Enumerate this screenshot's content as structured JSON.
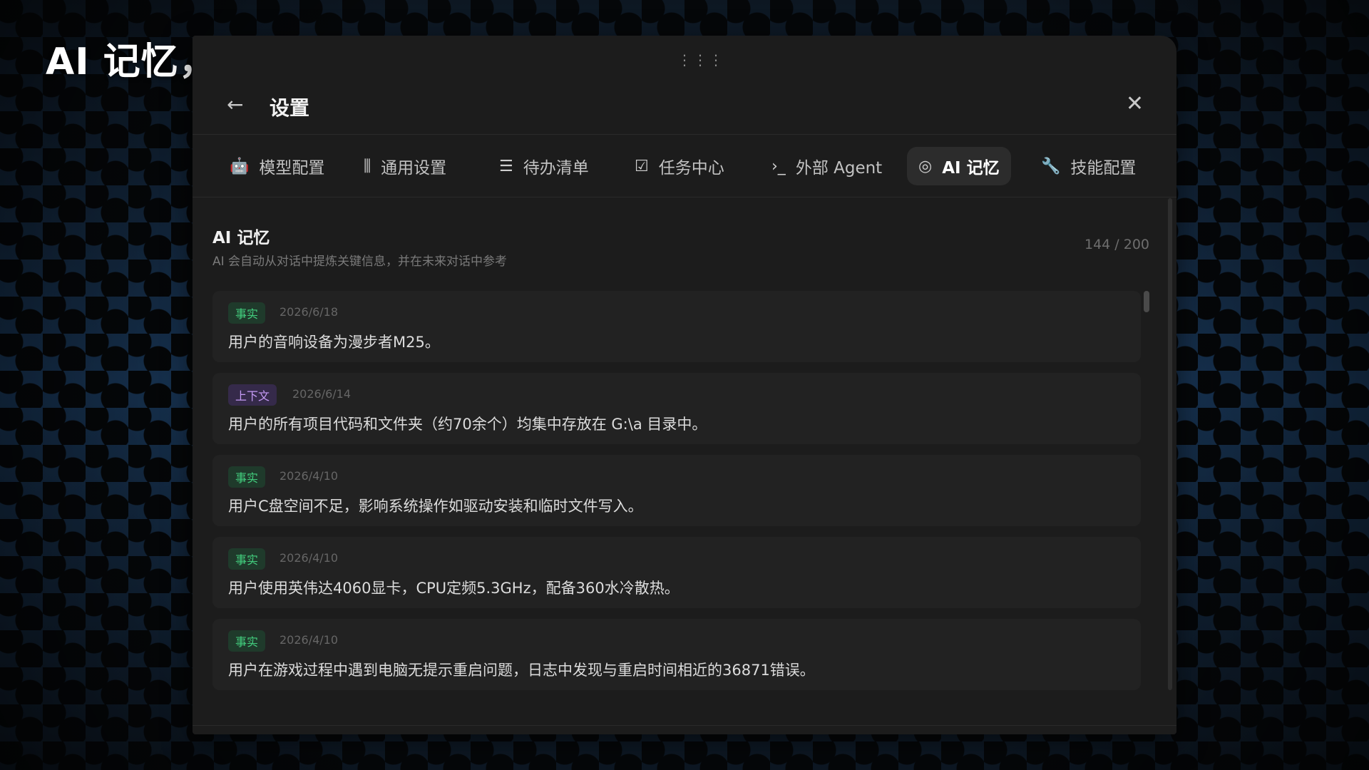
{
  "slogan": "AI 记忆，越用越懂你",
  "window": {
    "drag_glyph": "⋮⋮⋮",
    "back_glyph": "←",
    "title": "设置",
    "close_glyph": "✕"
  },
  "tabs": [
    {
      "icon": "robot-icon",
      "glyph": "🤖",
      "label": "模型配置",
      "active": false
    },
    {
      "icon": "sliders-icon",
      "glyph": "⫼",
      "label": "通用设置",
      "active": false
    },
    {
      "icon": "todo-list-icon",
      "glyph": "☰",
      "label": "待办清单",
      "active": false
    },
    {
      "icon": "checklist-icon",
      "glyph": "☑",
      "label": "任务中心",
      "active": false
    },
    {
      "icon": "terminal-icon",
      "glyph": "›_",
      "label": "外部 Agent",
      "active": false
    },
    {
      "icon": "brain-icon",
      "glyph": "◎",
      "label": "AI 记忆",
      "active": true
    },
    {
      "icon": "wrench-icon",
      "glyph": "🔧",
      "label": "技能配置",
      "active": false
    }
  ],
  "section": {
    "title": "AI 记忆",
    "description": "AI 会自动从对话中提炼关键信息，并在未来对话中参考",
    "count": "144 / 200"
  },
  "memories": [
    {
      "type": "fact",
      "badge": "事实",
      "date": "2026/6/18",
      "text": "用户的音响设备为漫步者M25。"
    },
    {
      "type": "ctx",
      "badge": "上下文",
      "date": "2026/6/14",
      "text": "用户的所有项目代码和文件夹（约70余个）均集中存放在 G:\\a 目录中。"
    },
    {
      "type": "fact",
      "badge": "事实",
      "date": "2026/4/10",
      "text": "用户C盘空间不足，影响系统操作如驱动安装和临时文件写入。"
    },
    {
      "type": "fact",
      "badge": "事实",
      "date": "2026/4/10",
      "text": "用户使用英伟达4060显卡，CPU定频5.3GHz，配备360水冷散热。"
    },
    {
      "type": "fact",
      "badge": "事实",
      "date": "2026/4/10",
      "text": "用户在游戏过程中遇到电脑无提示重启问题，日志中发现与重启时间相近的36871错误。"
    }
  ],
  "colors": {
    "fact_badge": "#43d07f",
    "context_badge": "#c59bf5",
    "window_bg": "#1c1c1c"
  }
}
